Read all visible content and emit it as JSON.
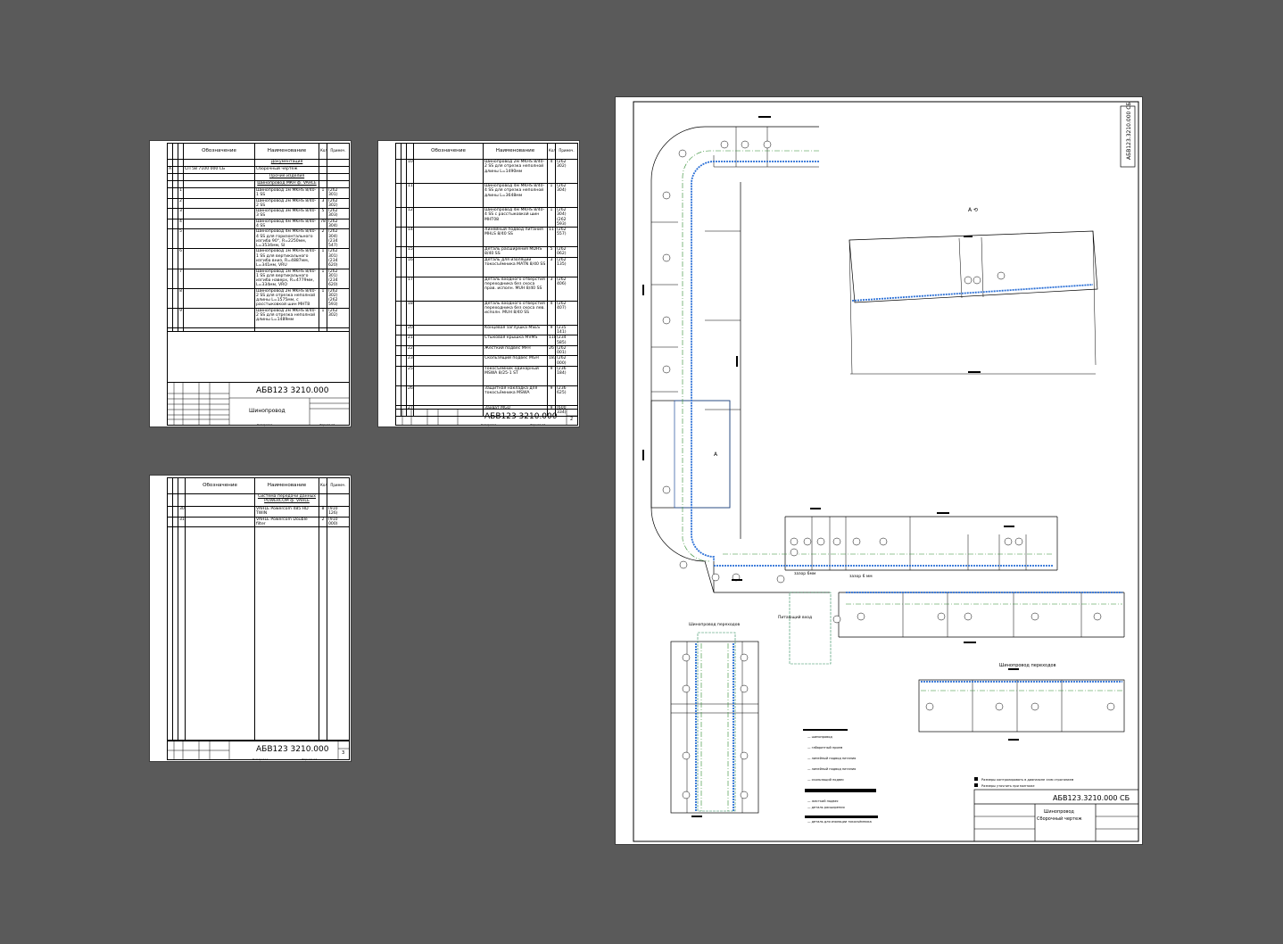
{
  "columns": {
    "designation": "Обозначение",
    "name": "Наименование",
    "qty": "Кол.",
    "note": "Примеч."
  },
  "sheet1": {
    "rows": [
      {
        "type": "section",
        "name": "Документация"
      },
      {
        "type": "item",
        "fmt": "А1",
        "pos": "",
        "designation": "СП 58 7100 000 СБ",
        "name": "Сборочный чертеж",
        "qty": "",
        "note": ""
      },
      {
        "type": "section",
        "name": "Прочие изделия"
      },
      {
        "type": "section",
        "name": "Шинопровод МКН ф. VAHLE"
      },
      {
        "type": "item",
        "fmt": "",
        "pos": "1",
        "designation": "",
        "name": "Шинопровод 1м MKHS 8/40-1 SS",
        "qty": "1",
        "note": "(262 301)"
      },
      {
        "type": "item",
        "fmt": "",
        "pos": "2",
        "designation": "",
        "name": "Шинопровод 2м MKHS 8/40-2 SS",
        "qty": "3",
        "note": "(262 302)"
      },
      {
        "type": "item",
        "fmt": "",
        "pos": "3",
        "designation": "",
        "name": "Шинопровод 3м MKHS 8/40-3 SS",
        "qty": "5",
        "note": "(262 303)"
      },
      {
        "type": "item",
        "fmt": "",
        "pos": "4",
        "designation": "",
        "name": "Шинопровод 4м MKHS 8/40-4 SS",
        "qty": "78",
        "note": "(262 304)"
      },
      {
        "type": "item",
        "fmt": "",
        "pos": "5",
        "designation": "",
        "name": "Шинопровод 4м MKHS 8/40-4 SS для горизонтального изгиба 90°, R=2250мм, L=3534мм, SI",
        "qty": "2",
        "note": "(262 304) (234 547)"
      },
      {
        "type": "item",
        "fmt": "",
        "pos": "6",
        "designation": "",
        "name": "Шинопровод 1м MKHS 8/40-1 SS для вертикального изгиба вниз, R=4887мм, L=341мм, VRU",
        "qty": "1",
        "note": "(262 301) (234 620)"
      },
      {
        "type": "item",
        "fmt": "",
        "pos": "7",
        "designation": "",
        "name": "Шинопровод 1м MKHS 8/40-1 SS для вертикального изгиба наверх, R=4779мм, L=334мм, VRO",
        "qty": "1",
        "note": "(262 301) (234 620)"
      },
      {
        "type": "item",
        "fmt": "",
        "pos": "8",
        "designation": "",
        "name": "Шинопровод 2м MKHS 8/40-2 SS для отрезка неполной длины L=1575мм, с расстыковкой шин MHT8",
        "qty": "1",
        "note": "(262 302) (262 593)"
      },
      {
        "type": "item",
        "fmt": "",
        "pos": "9",
        "designation": "",
        "name": "Шинопровод 2м MKHS 8/40-2 SS для отрезка неполной длины L=1489мм",
        "qty": "1",
        "note": "(262 302)"
      }
    ],
    "code": "АБВ123 3210.000",
    "title": "Шинопровод",
    "stamp_labels": [
      "Изм",
      "Лист",
      "№ докум.",
      "Подп.",
      "Дата",
      "Разраб.",
      "Пров.",
      "Т.контр.",
      "Н.контр.",
      "Утв.",
      "Лит.",
      "Лист",
      "Листов"
    ],
    "copied": "Копировал",
    "format": "Формат А4"
  },
  "sheet2": {
    "rows": [
      {
        "pos": "10",
        "name": "Шинопровод 2м MKHS 8/40-2 SS для отрезка неполной длины L=1490мм",
        "qty": "4",
        "note": "(262 302)"
      },
      {
        "pos": "11",
        "name": "Шинопровод 4м MKHS 8/40-4 SS для отрезка неполной длины L=3648мм",
        "qty": "1",
        "note": "(262 304)"
      },
      {
        "pos": "12",
        "name": "Шинопровод 4м MKHS 8/40-4 SS с расстыковкой шин MHT08",
        "qty": "1",
        "note": "(262 304) (262 593)"
      },
      {
        "pos": "14",
        "name": "Линейный подвод питания MHLS 8/40 SS",
        "qty": "11",
        "note": "(262 557)"
      },
      {
        "pos": "15",
        "name": "Деталь расширения MDHS 8/40 SS",
        "qty": "5",
        "note": "(262 062)"
      },
      {
        "pos": "16",
        "name": "Деталь для изоляции токосъёмника MATN 8/40 SS",
        "qty": "3",
        "note": "(262 135)"
      },
      {
        "pos": "17",
        "name": "Деталь входного отверстия переходника без скоса прав. исполн. MUH 8/40 SS",
        "qty": "3",
        "note": "(262 406)"
      },
      {
        "pos": "18",
        "name": "Деталь входного отверстия переходника без скоса лев. исполн. MUH 8/40 SS",
        "qty": "4",
        "note": "(262 407)"
      },
      {
        "pos": "20",
        "name": "Концевая заглушка MSES",
        "qty": "9",
        "note": "(235 141)"
      },
      {
        "pos": "21",
        "name": "Стыковая крышка MVMS",
        "qty": "118",
        "note": "(234 585)"
      },
      {
        "pos": "22",
        "name": "Жесткий подвес MFH",
        "qty": "26",
        "note": "(262 001)"
      },
      {
        "pos": "23",
        "name": "Скользящий подвес MGH",
        "qty": "183",
        "note": "(262 000)"
      },
      {
        "pos": "25",
        "name": "Токосъёмник одинарный MSWA 8/25-1 ST",
        "qty": "9",
        "note": "(236 184)"
      },
      {
        "pos": "26",
        "name": "Защитная накладка для токосъёмника MSWA",
        "qty": "9",
        "note": "(236 625)"
      },
      {
        "pos": "27",
        "name": "Захват MGU",
        "qty": "9",
        "note": "(600 334)"
      }
    ],
    "code": "АБВ123 3210.000",
    "sheet_no": "2",
    "copied": "Копировал",
    "format": "Формат А4"
  },
  "sheet3": {
    "rows": [
      {
        "pos": "",
        "name": "Система передачи данных POWERCOM ф. VAHLE",
        "qty": "",
        "note": "",
        "section": true
      },
      {
        "pos": "30",
        "name": "VAHLE Powercom 485 HD TWIN",
        "qty": "8",
        "note": "(910 126)"
      },
      {
        "pos": "31",
        "name": "VAHLE Powercom Double filter",
        "qty": "2",
        "note": "(910 000)"
      }
    ],
    "code": "АБВ123 3210.000",
    "sheet_no": "3",
    "copied": "Копировал",
    "format": "Формат А4"
  },
  "drawing": {
    "code_vertical": "АБВ123.3210.000 СБ",
    "stamp_code": "АБВ123.3210.000 СБ",
    "stamp_title": "Шинопровод",
    "stamp_subtitle": "Сборочный чертеж",
    "view_a": "А",
    "view_a_rot": "А ⟲",
    "side_view": "Шинопровод переходов",
    "extension_view": "Шинопровод переходов",
    "power_supply": "Питающий вход",
    "gap1": "зазор 6мм",
    "gap2": "зазор 6 мм",
    "notes": [
      "Размеры контролировать в диапазоне ±мм строганием",
      "Размеры уточнить при монтаже"
    ],
    "legend": [
      "— шинопровод",
      "— габаритный проем",
      "— линейный подвод питания",
      "— линейный подвод питания",
      "— скользящий подвес",
      "— жесткий подвес",
      "— деталь расширения",
      "— деталь для изоляции токосъёмника"
    ]
  }
}
